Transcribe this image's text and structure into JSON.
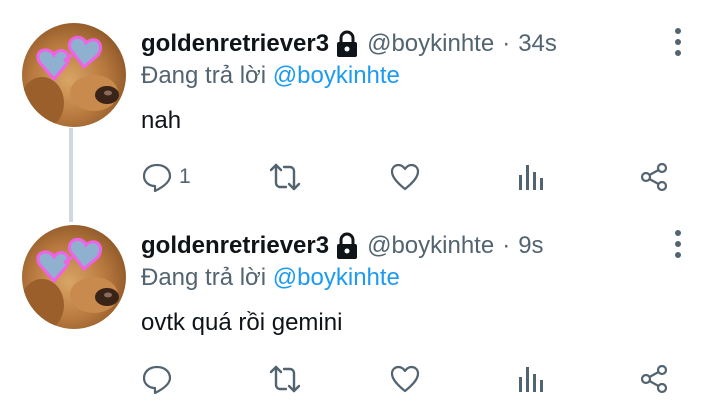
{
  "tweets": [
    {
      "name": "goldenretriever3",
      "handle": "@boykinhte",
      "separator": "·",
      "time": "34s",
      "replying_prefix": "Đang trả lời",
      "replying_to": "@boykinhte",
      "text": "nah",
      "reply_count": "1"
    },
    {
      "name": "goldenretriever3",
      "handle": "@boykinhte",
      "separator": "·",
      "time": "9s",
      "replying_prefix": "Đang trả lời",
      "replying_to": "@boykinhte",
      "text": "ovtk quá rồi gemini",
      "reply_count": ""
    }
  ],
  "icons": {
    "lock": "lock-icon",
    "more": "more-vertical-icon",
    "reply": "reply-icon",
    "retweet": "retweet-icon",
    "like": "heart-icon",
    "views": "views-icon",
    "share": "share-icon"
  },
  "colors": {
    "text": "#0f1419",
    "secondary": "#536471",
    "mention": "#1d9bf0",
    "thread_line": "#cfd9de"
  }
}
